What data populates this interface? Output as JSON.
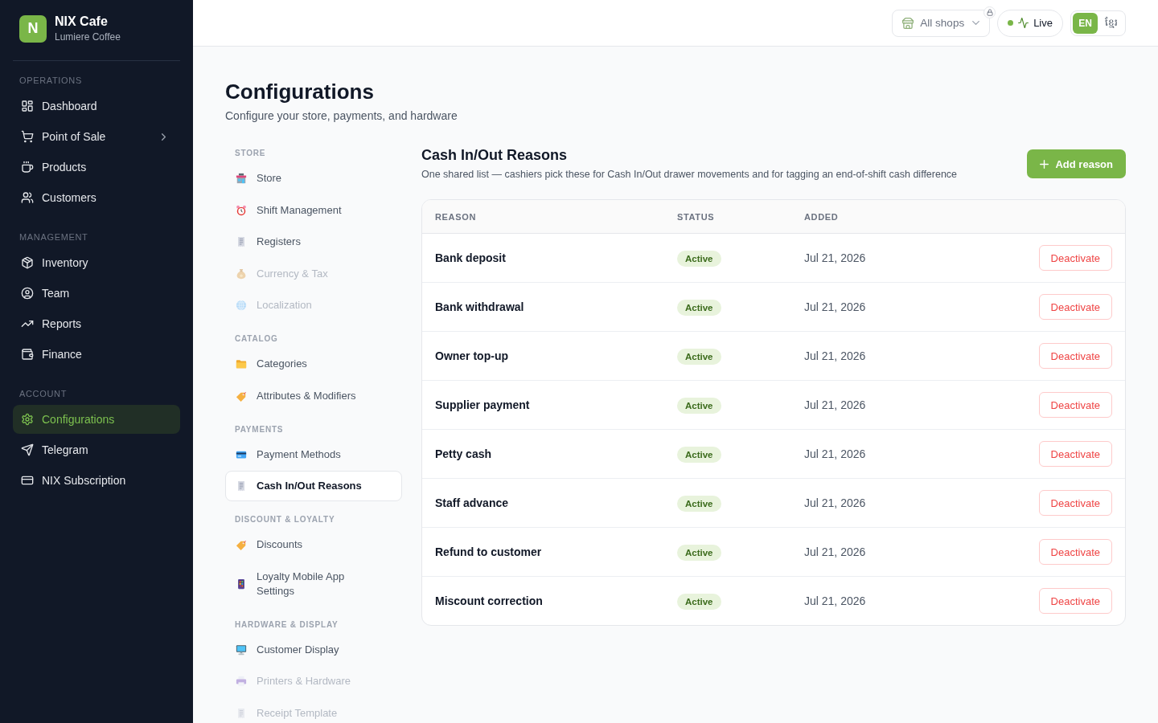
{
  "sidebar": {
    "brand": {
      "logo_letter": "N",
      "name": "NIX Cafe",
      "subtitle": "Lumiere Coffee"
    },
    "sections": [
      {
        "title": "OPERATIONS",
        "items": [
          {
            "label": "Dashboard",
            "selected": false,
            "expandable": false
          },
          {
            "label": "Point of Sale",
            "selected": false,
            "expandable": true
          },
          {
            "label": "Products",
            "selected": false,
            "expandable": false
          },
          {
            "label": "Customers",
            "selected": false,
            "expandable": false
          }
        ]
      },
      {
        "title": "MANAGEMENT",
        "items": [
          {
            "label": "Inventory",
            "selected": false,
            "expandable": false
          },
          {
            "label": "Team",
            "selected": false,
            "expandable": false
          },
          {
            "label": "Reports",
            "selected": false,
            "expandable": false
          },
          {
            "label": "Finance",
            "selected": false,
            "expandable": false
          }
        ]
      },
      {
        "title": "ACCOUNT",
        "items": [
          {
            "label": "Configurations",
            "selected": true,
            "expandable": false
          },
          {
            "label": "Telegram",
            "selected": false,
            "expandable": false
          },
          {
            "label": "NIX Subscription",
            "selected": false,
            "expandable": false
          }
        ]
      }
    ]
  },
  "top_bar": {
    "shop_selector": {
      "label": "All shops",
      "locked": true
    },
    "live": {
      "label": "Live",
      "on": true
    },
    "language": {
      "options": [
        {
          "label": "EN",
          "selected": true
        },
        {
          "label": "ខ្មែរ",
          "selected": false
        }
      ]
    }
  },
  "page": {
    "title": "Configurations",
    "subtitle": "Configure your store, payments, and hardware"
  },
  "config_nav": {
    "sections": [
      {
        "title": "STORE",
        "items": [
          {
            "label": "Store",
            "selected": false,
            "disabled": false
          },
          {
            "label": "Shift Management",
            "selected": false,
            "disabled": false
          },
          {
            "label": "Registers",
            "selected": false,
            "disabled": false
          },
          {
            "label": "Currency & Tax",
            "selected": false,
            "disabled": true
          },
          {
            "label": "Localization",
            "selected": false,
            "disabled": true
          }
        ]
      },
      {
        "title": "CATALOG",
        "items": [
          {
            "label": "Categories",
            "selected": false,
            "disabled": false
          },
          {
            "label": "Attributes & Modifiers",
            "selected": false,
            "disabled": false
          }
        ]
      },
      {
        "title": "PAYMENTS",
        "items": [
          {
            "label": "Payment Methods",
            "selected": false,
            "disabled": false
          },
          {
            "label": "Cash In/Out Reasons",
            "selected": true,
            "disabled": false
          }
        ]
      },
      {
        "title": "DISCOUNT & LOYALTY",
        "items": [
          {
            "label": "Discounts",
            "selected": false,
            "disabled": false
          },
          {
            "label": "Loyalty Mobile App Settings",
            "selected": false,
            "disabled": false
          }
        ]
      },
      {
        "title": "HARDWARE & DISPLAY",
        "items": [
          {
            "label": "Customer Display",
            "selected": false,
            "disabled": false
          },
          {
            "label": "Printers & Hardware",
            "selected": false,
            "disabled": true
          },
          {
            "label": "Receipt Template",
            "selected": false,
            "disabled": true
          }
        ]
      }
    ]
  },
  "panel": {
    "title": "Cash In/Out Reasons",
    "description": "One shared list — cashiers pick these for Cash In/Out drawer movements and for tagging an end-of-shift cash difference",
    "add_button": "Add reason",
    "table": {
      "columns": [
        "REASON",
        "STATUS",
        "ADDED"
      ],
      "rows": [
        {
          "reason": "Bank deposit",
          "status": "Active",
          "active": true,
          "added": "Jul 21, 2026",
          "action": "Deactivate"
        },
        {
          "reason": "Bank withdrawal",
          "status": "Active",
          "active": true,
          "added": "Jul 21, 2026",
          "action": "Deactivate"
        },
        {
          "reason": "Owner top-up",
          "status": "Active",
          "active": true,
          "added": "Jul 21, 2026",
          "action": "Deactivate"
        },
        {
          "reason": "Supplier payment",
          "status": "Active",
          "active": true,
          "added": "Jul 21, 2026",
          "action": "Deactivate"
        },
        {
          "reason": "Petty cash",
          "status": "Active",
          "active": true,
          "added": "Jul 21, 2026",
          "action": "Deactivate"
        },
        {
          "reason": "Staff advance",
          "status": "Active",
          "active": true,
          "added": "Jul 21, 2026",
          "action": "Deactivate"
        },
        {
          "reason": "Refund to customer",
          "status": "Active",
          "active": true,
          "added": "Jul 21, 2026",
          "action": "Deactivate"
        },
        {
          "reason": "Miscount correction",
          "status": "Active",
          "active": true,
          "added": "Jul 21, 2026",
          "action": "Deactivate"
        }
      ]
    }
  }
}
